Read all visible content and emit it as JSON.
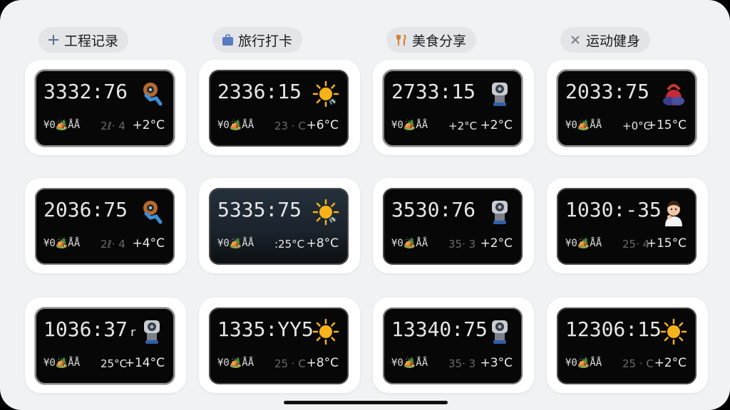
{
  "categories": [
    {
      "label": "工程记录",
      "icon": "plus-icon"
    },
    {
      "label": "旅行打卡",
      "icon": "suitcase-icon"
    },
    {
      "label": "美食分享",
      "icon": "fork-knife-icon"
    },
    {
      "label": "运动健身",
      "icon": "close-icon"
    }
  ],
  "widgets": [
    {
      "time": "3332:76",
      "location": "¥0🏕️ÅÅ",
      "mid": "2ℓ· 4",
      "temp": "+2°C",
      "icon": "robot-blue-icon"
    },
    {
      "time": "2336:15",
      "location": "¥0🏕️ÅÅ",
      "mid": "23 · C",
      "temp": "+6°C",
      "icon": "sun-icon"
    },
    {
      "time": "2733:15",
      "location": "¥0🏕️ÅÅ",
      "mid": "+2°C",
      "temp": "+2°C",
      "icon": "robot-grey-icon"
    },
    {
      "time": "2033:75",
      "location": "¥0🏕️ÅÅ",
      "mid": "+0°C",
      "temp": "+15°C",
      "icon": "kettlebell-icon"
    },
    {
      "time": "2036:75",
      "location": "¥0🏕️ÅÅ",
      "mid": "2ℓ· 4",
      "temp": "+4°C",
      "icon": "robot-blue-icon"
    },
    {
      "time": "5335:75",
      "location": "¥0🏕️ÅÅ",
      "mid": ":25°C",
      "temp": "+8°C",
      "icon": "sun-icon"
    },
    {
      "time": "3530:76",
      "location": "¥0🏕️ÅÅ",
      "mid": "35· 3",
      "temp": "+2°C",
      "icon": "robot-grey-icon"
    },
    {
      "time": "1030:-35",
      "location": "¥0🏕️ÅÅ",
      "mid": "25· 4",
      "temp": "+15°C",
      "icon": "person-icon"
    },
    {
      "time": "1036:37ᵣ",
      "location": "¥0🏕️ÅÅ",
      "mid": "25°C",
      "temp": "+14°C",
      "icon": "robot-grey-icon"
    },
    {
      "time": "1335:YY5",
      "location": "¥0🏕️ÅÅ",
      "mid": "25 · C",
      "temp": "+8°C",
      "icon": "sun-icon"
    },
    {
      "time": "13340:75",
      "location": "¥0🏕️ÅÅ",
      "mid": "35· 3",
      "temp": "+3°C",
      "icon": "robot-grey-icon"
    },
    {
      "time": "12306:15",
      "location": "¥0🏕️ÅÅ",
      "mid": "25 · C",
      "temp": "+2°C",
      "icon": "sun-icon"
    }
  ]
}
